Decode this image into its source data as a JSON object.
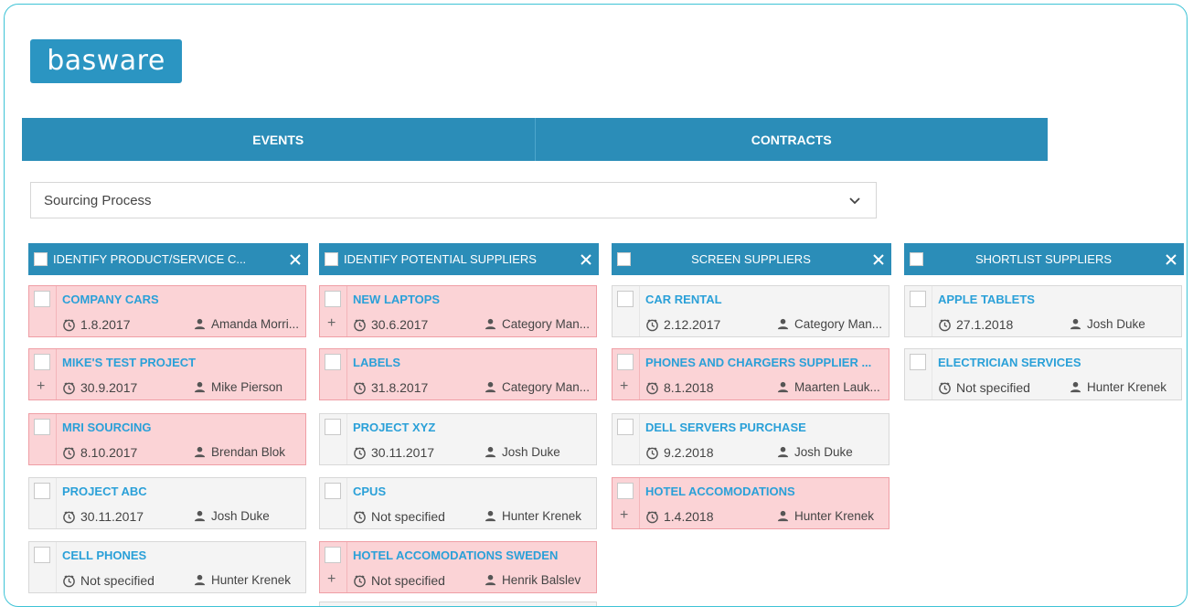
{
  "brand": {
    "logo_text": "basware"
  },
  "tabs": [
    {
      "label": "EVENTS"
    },
    {
      "label": "CONTRACTS"
    }
  ],
  "process_select": {
    "value": "Sourcing Process"
  },
  "columns": [
    {
      "title": "IDENTIFY PRODUCT/SERVICE C...",
      "cards": [
        {
          "name": "COMPANY CARS",
          "date": "1.8.2017",
          "owner": "Amanda Morri...",
          "status": "overdue",
          "plus": false
        },
        {
          "name": "MIKE'S TEST PROJECT",
          "date": "30.9.2017",
          "owner": "Mike Pierson",
          "status": "overdue",
          "plus": true
        },
        {
          "name": "MRI SOURCING",
          "date": "8.10.2017",
          "owner": "Brendan Blok",
          "status": "overdue",
          "plus": false
        },
        {
          "name": "PROJECT ABC",
          "date": "30.11.2017",
          "owner": "Josh Duke",
          "status": "normal",
          "plus": false
        },
        {
          "name": "CELL PHONES",
          "date": "Not specified",
          "owner": "Hunter Krenek",
          "status": "normal",
          "plus": false
        }
      ]
    },
    {
      "title": "IDENTIFY POTENTIAL SUPPLIERS",
      "cards": [
        {
          "name": "NEW LAPTOPS",
          "date": "30.6.2017",
          "owner": "Category Man...",
          "status": "overdue",
          "plus": true
        },
        {
          "name": "LABELS",
          "date": "31.8.2017",
          "owner": "Category Man...",
          "status": "overdue",
          "plus": false
        },
        {
          "name": "PROJECT XYZ",
          "date": "30.11.2017",
          "owner": "Josh Duke",
          "status": "normal",
          "plus": false
        },
        {
          "name": "CPUS",
          "date": "Not specified",
          "owner": "Hunter Krenek",
          "status": "normal",
          "plus": false
        },
        {
          "name": "HOTEL ACCOMODATIONS SWEDEN",
          "date": "Not specified",
          "owner": "Henrik Balslev",
          "status": "overdue",
          "plus": true
        }
      ]
    },
    {
      "title": "SCREEN SUPPLIERS",
      "cards": [
        {
          "name": "CAR RENTAL",
          "date": "2.12.2017",
          "owner": "Category Man...",
          "status": "normal",
          "plus": false
        },
        {
          "name": "PHONES AND CHARGERS SUPPLIER ...",
          "date": "8.1.2018",
          "owner": "Maarten Lauk...",
          "status": "overdue",
          "plus": true
        },
        {
          "name": "DELL SERVERS PURCHASE",
          "date": "9.2.2018",
          "owner": "Josh Duke",
          "status": "normal",
          "plus": false
        },
        {
          "name": "HOTEL ACCOMODATIONS",
          "date": "1.4.2018",
          "owner": "Hunter Krenek",
          "status": "overdue",
          "plus": true
        }
      ]
    },
    {
      "title": "SHORTLIST SUPPLIERS",
      "cards": [
        {
          "name": "APPLE TABLETS",
          "date": "27.1.2018",
          "owner": "Josh Duke",
          "status": "normal",
          "plus": false
        },
        {
          "name": "ELECTRICIAN SERVICES",
          "date": "Not specified",
          "owner": "Hunter Krenek",
          "status": "normal",
          "plus": false
        }
      ]
    }
  ],
  "colors": {
    "accent": "#2b8db8",
    "overdue_bg": "#fbd3d6",
    "link": "#2aa0d8"
  },
  "icons": {
    "date": "clock-icon",
    "owner": "person-icon",
    "close": "close-icon",
    "dropdown": "chevron-down-icon",
    "add": "plus-icon"
  }
}
